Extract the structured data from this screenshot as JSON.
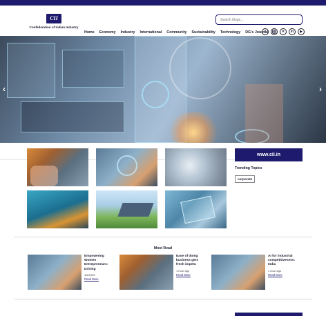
{
  "header": {
    "logo_mark": "CII",
    "logo_text": "Confederation of Indian Industry",
    "search_placeholder": "Search blogs...",
    "nav": [
      "Home",
      "Economy",
      "Industry",
      "International",
      "Community",
      "Sustainability",
      "Technology",
      "DG's Journal"
    ],
    "active_nav": "Home",
    "social_icons": [
      "facebook-icon",
      "instagram-icon",
      "x-icon",
      "linkedin-icon",
      "youtube-icon"
    ]
  },
  "hero": {
    "prev_glyph": "‹",
    "next_glyph": "›"
  },
  "sidebar": {
    "site_button": "www.cii.in",
    "trending_title": "Trending Topics",
    "tags": [
      "corporate"
    ]
  },
  "most_read": {
    "title": "Most Read",
    "items": [
      {
        "title": "Empowering Women Entrepreneurs: Driving",
        "date": "4/6/2025",
        "link": "Read More"
      },
      {
        "title": "Ease of doing business gets fresh impetu",
        "date": "1 hour ago",
        "link": "Read More"
      },
      {
        "title": "AI for industrial competitiveness: India",
        "date": "1 hour ago",
        "link": "Read More"
      }
    ]
  },
  "colors": {
    "brand": "#1e1b6e",
    "text": "#1a1a2e"
  }
}
